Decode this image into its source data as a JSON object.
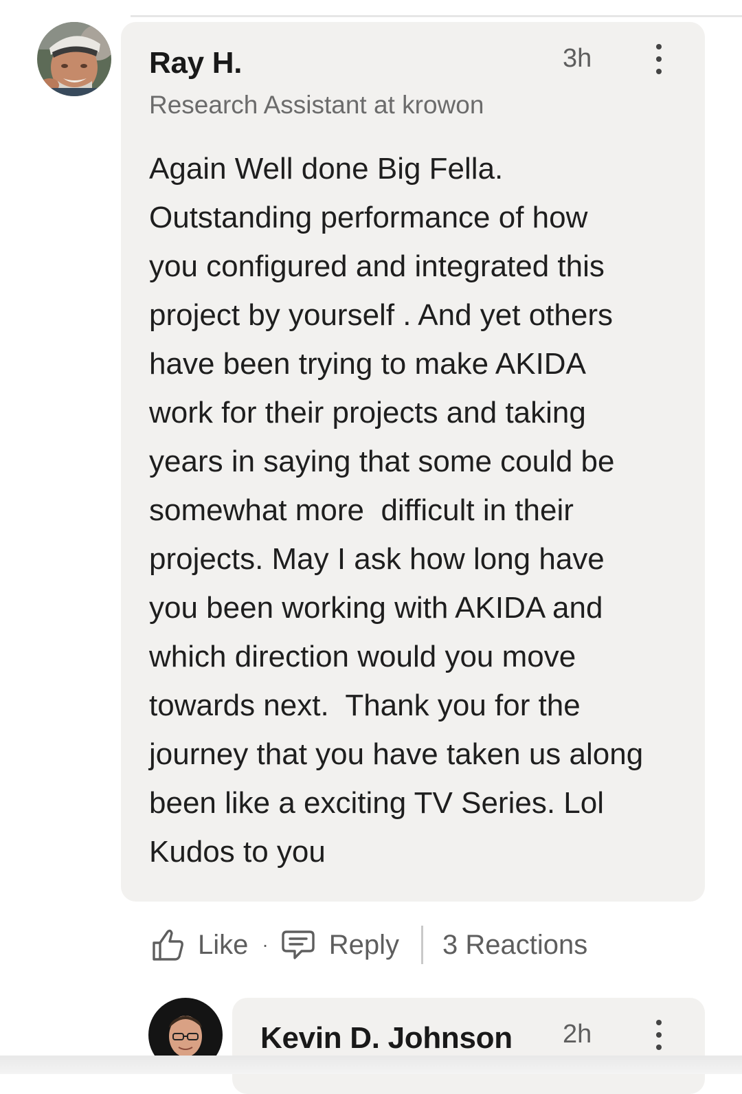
{
  "comments": [
    {
      "author": "Ray H.",
      "headline": "Research Assistant at krowon",
      "time": "3h",
      "body_lines": [
        "Again Well done Big Fella.",
        "Outstanding performance of how",
        "you configured and integrated this",
        "project by yourself . And yet others",
        "have been trying to make AKIDA",
        "work for their projects and taking",
        "years in saying that some could be",
        "somewhat more  difficult in their",
        "projects. May I ask how long have",
        "you been working with AKIDA and",
        "which direction would you move",
        "towards next.  Thank you for the",
        "journey that you have taken us along",
        "been like a exciting TV Series. Lol",
        "Kudos to you"
      ],
      "actions": {
        "like_label": "Like",
        "separator": "·",
        "reply_label": "Reply",
        "reactions_label": "3 Reactions"
      }
    },
    {
      "author": "Kevin D. Johnson",
      "time": "2h"
    }
  ],
  "colors": {
    "bubble_bg": "#f2f1ef",
    "secondary_text": "#6b6b6b",
    "primary_text": "#1e1e1e"
  },
  "icons": [
    "thumbs-up-icon",
    "speech-bubble-icon",
    "more-vertical-icon"
  ]
}
